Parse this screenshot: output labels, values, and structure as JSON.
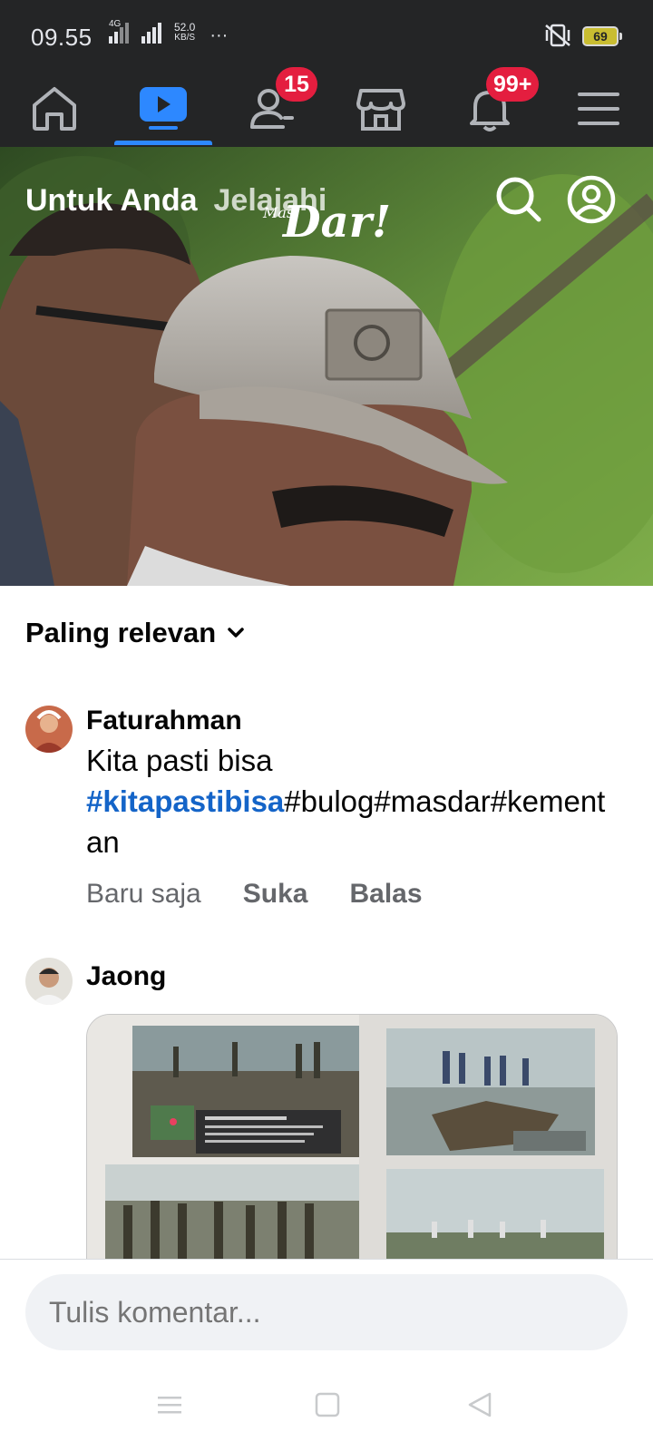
{
  "status_bar": {
    "time": "09.55",
    "network": "4G",
    "speed_value": "52.0",
    "speed_unit": "KB/S",
    "more": "···",
    "battery": "69"
  },
  "top_nav": {
    "items": [
      {
        "name": "home",
        "icon": "home-icon"
      },
      {
        "name": "video",
        "icon": "video-play-icon",
        "active": true
      },
      {
        "name": "friends",
        "icon": "friends-icon",
        "badge": "15"
      },
      {
        "name": "marketplace",
        "icon": "store-icon"
      },
      {
        "name": "notifications",
        "icon": "bell-icon",
        "badge": "99+"
      },
      {
        "name": "menu",
        "icon": "hamburger-icon"
      }
    ],
    "accent_color": "#2d88ff",
    "badge_color": "#e41e3f"
  },
  "video": {
    "tabs": [
      "Untuk Anda",
      "Jelajahi"
    ],
    "watermark_small": "Mas",
    "watermark": "Dar!",
    "icons": [
      "search-icon",
      "profile-icon"
    ]
  },
  "comments_section": {
    "sort_label": "Paling relevan",
    "comments": [
      {
        "author": "Faturahman",
        "text_plain": "Kita pasti bisa",
        "hashtag_highlight": "#kitapastibisa",
        "text_rest": "#bulog#masdar#kementan",
        "time": "Baru saja",
        "like_label": "Suka",
        "reply_label": "Balas"
      },
      {
        "author": "Jaong",
        "has_photo": true
      }
    ]
  },
  "composer": {
    "placeholder": "Tulis komentar..."
  },
  "system_nav": {
    "icons": [
      "recents-icon",
      "home-square-icon",
      "back-triangle-icon"
    ]
  }
}
